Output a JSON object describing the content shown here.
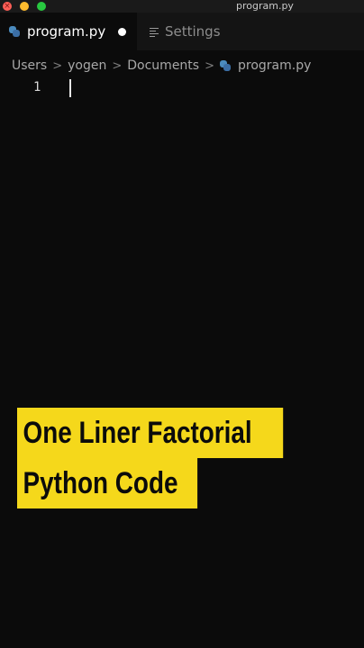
{
  "window": {
    "title": "program.py",
    "close_glyph": "×"
  },
  "tabs": [
    {
      "label": "program.py",
      "icon": "python-file-icon",
      "active": true,
      "unsaved": true
    },
    {
      "label": "Settings",
      "icon": "settings-list-icon",
      "active": false
    }
  ],
  "breadcrumbs": [
    "Users",
    "yogen",
    "Documents",
    "program.py"
  ],
  "breadcrumb_separator": ">",
  "editor": {
    "line_numbers": [
      "1"
    ]
  },
  "caption": {
    "line1": "One Liner Factorial",
    "line2": "Python Code"
  },
  "colors": {
    "background": "#0b0b0b",
    "caption_bg": "#f5d81b",
    "python_icon": "#4b8bbe",
    "traffic_close": "#ff5f57",
    "traffic_min": "#febc2e",
    "traffic_max": "#28c840"
  }
}
